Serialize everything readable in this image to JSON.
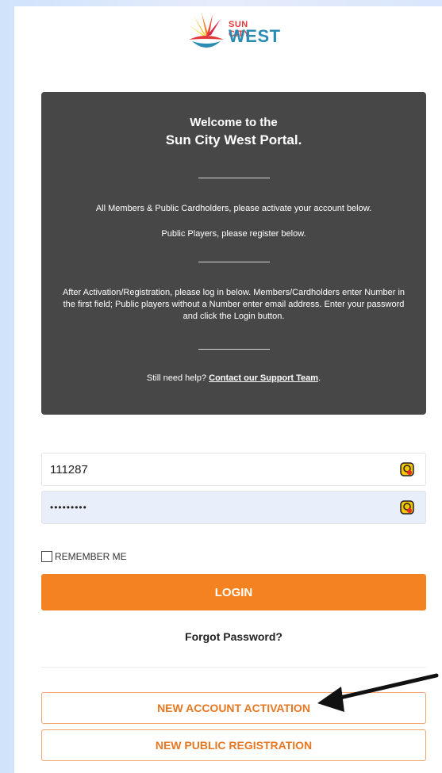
{
  "brand": {
    "line1": "SUN CITY",
    "line2": "WEST"
  },
  "welcome": {
    "title_line1": "Welcome to the",
    "title_line2": "Sun City West Portal.",
    "para_activate": "All Members & Public Cardholders, please activate your account below.",
    "para_register": "Public Players, please register below.",
    "para_login": "After Activation/Registration, please log in below. Members/Cardholders enter Number in the first field; Public players without a Number enter email address. Enter your password and click the Login button.",
    "help_prefix": "Still need help? ",
    "help_link": "Contact our Support Team",
    "help_suffix": "."
  },
  "login_form": {
    "username_value": "111287",
    "password_value": "•••••••••",
    "remember_label": "REMEMBER ME",
    "login_label": "LOGIN",
    "forgot_label": "Forgot Password?"
  },
  "actions": {
    "activation_label": "NEW ACCOUNT ACTIVATION",
    "registration_label": "NEW PUBLIC REGISTRATION"
  },
  "colors": {
    "accent": "#f58220",
    "panel_dark": "#474747"
  },
  "icons": {
    "logo": "sunburst-logo-icon",
    "password_manager": "key-manager-icon",
    "annotation": "arrow-pointer-icon"
  }
}
